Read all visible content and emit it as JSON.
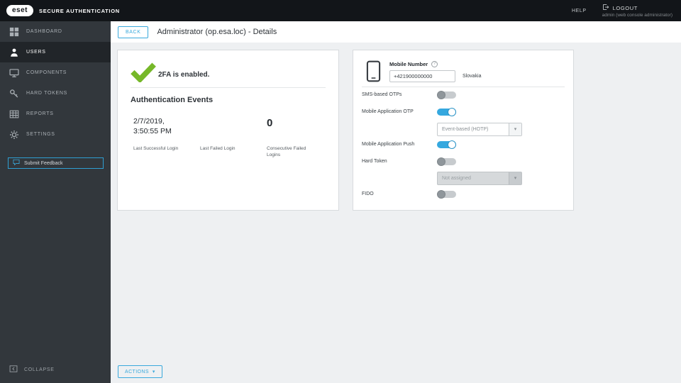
{
  "topbar": {
    "brand": "eset",
    "product": "SECURE AUTHENTICATION",
    "help_label": "HELP",
    "logout_label": "LOGOUT",
    "user_label": "admin (web console administrator)"
  },
  "sidebar": {
    "items": [
      {
        "label": "DASHBOARD",
        "icon": "dashboard-icon",
        "active": false
      },
      {
        "label": "USERS",
        "icon": "users-icon",
        "active": true
      },
      {
        "label": "COMPONENTS",
        "icon": "components-icon",
        "active": false
      },
      {
        "label": "HARD TOKENS",
        "icon": "hard-tokens-icon",
        "active": false
      },
      {
        "label": "REPORTS",
        "icon": "reports-icon",
        "active": false
      },
      {
        "label": "SETTINGS",
        "icon": "settings-icon",
        "active": false
      }
    ],
    "feedback_label": "Submit Feedback",
    "collapse_label": "COLLAPSE"
  },
  "page": {
    "back_label": "BACK",
    "title": "Administrator (op.esa.loc) - Details",
    "actions_label": "ACTIONS"
  },
  "status_card": {
    "enabled_text": "2FA is enabled.",
    "events_title": "Authentication Events",
    "events": [
      {
        "value": "2/7/2019, 3:50:55 PM",
        "label": "Last Successful Login"
      },
      {
        "value": "",
        "label": "Last Failed Login"
      },
      {
        "value": "0",
        "label": "Consecutive Failed Logins"
      }
    ]
  },
  "mobile_card": {
    "number_label": "Mobile Number",
    "number_value": "+421900000000",
    "country": "Slovakia",
    "rows": [
      {
        "label": "SMS-based OTPs",
        "on": false
      },
      {
        "label": "Mobile Application OTP",
        "on": true
      },
      {
        "label": "Mobile Application Push",
        "on": true
      },
      {
        "label": "Hard Token",
        "on": false
      },
      {
        "label": "FIDO",
        "on": false
      }
    ],
    "otp_type": "Event-based (HOTP)",
    "hard_token_value": "Not assigned"
  },
  "icons": {
    "question": "?",
    "chevron_down": "▾"
  },
  "colors": {
    "accent_blue": "#39a9dc",
    "success_green": "#76b829",
    "topbar_bg": "#121519",
    "sidebar_bg": "#32373c"
  }
}
